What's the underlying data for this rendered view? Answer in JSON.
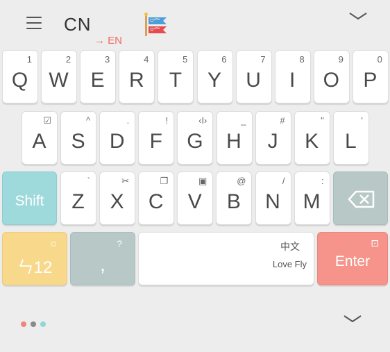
{
  "toolbar": {
    "icons": [
      "menu-icon",
      "flag-icon",
      "chevron-down-icon"
    ],
    "lang_label": "CN",
    "switch_hint": "→ EN"
  },
  "rows": [
    [
      {
        "label": "Q",
        "sub": "1"
      },
      {
        "label": "W",
        "sub": "2"
      },
      {
        "label": "E",
        "sub": "3"
      },
      {
        "label": "R",
        "sub": "4"
      },
      {
        "label": "T",
        "sub": "5"
      },
      {
        "label": "Y",
        "sub": "6"
      },
      {
        "label": "U",
        "sub": "7"
      },
      {
        "label": "I",
        "sub": "8"
      },
      {
        "label": "O",
        "sub": "9"
      },
      {
        "label": "P",
        "sub": "0"
      }
    ],
    [
      {
        "label": "A",
        "sub": "☑"
      },
      {
        "label": "S",
        "sub": "^"
      },
      {
        "label": "D",
        "sub": "."
      },
      {
        "label": "F",
        "sub": "!"
      },
      {
        "label": "G",
        "sub": "‹I›"
      },
      {
        "label": "H",
        "sub": "_"
      },
      {
        "label": "J",
        "sub": "#"
      },
      {
        "label": "K",
        "sub": "\""
      },
      {
        "label": "L",
        "sub": "'"
      }
    ],
    [
      {
        "label": "Z",
        "sub": "`"
      },
      {
        "label": "X",
        "sub": "✂"
      },
      {
        "label": "C",
        "sub": "❐"
      },
      {
        "label": "V",
        "sub": "▣"
      },
      {
        "label": "B",
        "sub": "@"
      },
      {
        "label": "N",
        "sub": "/"
      },
      {
        "label": "M",
        "sub": ":"
      }
    ]
  ],
  "shift_label": "Shift",
  "numbers_label": "ㄣ12",
  "numbers_sub": "☼",
  "comma_label": ",",
  "comma_sub": "?",
  "space_lang": "中文",
  "space_label": "Love Fly",
  "enter_label": "Enter",
  "enter_sub": "⊡",
  "colors": {
    "background": "#ededed",
    "key": "#ffffff",
    "shift": "#9ed9dc",
    "backspace": "#b7c8c7",
    "numbers": "#f8d98b",
    "enter": "#f6938a",
    "accent": "#f06b5e",
    "dots": [
      "#f0857b",
      "#8a8a8a",
      "#8fd6d8"
    ]
  }
}
